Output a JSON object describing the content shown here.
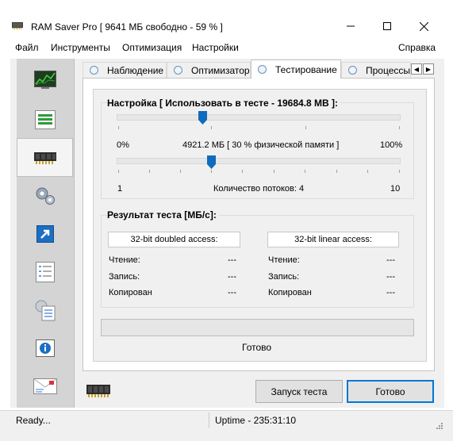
{
  "window": {
    "title": "RAM Saver Pro [ 9641 МБ свободно - 59 % ]",
    "controls": {
      "minimize": "—",
      "maximize": "☐",
      "close": "✕"
    }
  },
  "menu": {
    "file": "Файл",
    "tools": "Инструменты",
    "optimize": "Оптимизация",
    "settings": "Настройки",
    "help": "Справка"
  },
  "sidebar": {
    "items": [
      {
        "icon": "monitor-chart-icon"
      },
      {
        "icon": "list-bars-icon"
      },
      {
        "icon": "ram-chip-icon",
        "active": true
      },
      {
        "icon": "gears-icon"
      },
      {
        "icon": "shortcut-arrow-icon"
      },
      {
        "icon": "checklist-icon"
      },
      {
        "icon": "settings-document-icon"
      },
      {
        "icon": "info-icon"
      },
      {
        "icon": "envelope-icon"
      }
    ]
  },
  "tabs": {
    "monitoring": "Наблюдение",
    "optimizer": "Оптимизатор",
    "testing": "Тестирование",
    "processes": "Процессы",
    "active": "testing"
  },
  "setup": {
    "title": "Настройка [ Использовать в тесте - 19684.8 MB ]:",
    "memory_slider": {
      "min_label": "0%",
      "max_label": "100%",
      "value_label": "4921.2 МБ [ 30 % физической памяти ]",
      "value_percent": 30
    },
    "threads_slider": {
      "min_label": "1",
      "max_label": "10",
      "value_label": "Количество потоков: 4",
      "value": 4
    }
  },
  "results": {
    "title": "Результат теста [МБ/с]:",
    "doubled": {
      "header": "32-bit doubled access:",
      "read_label": "Чтение:",
      "read_value": "---",
      "write_label": "Запись:",
      "write_value": "---",
      "copy_label": "Копирован",
      "copy_value": "---"
    },
    "linear": {
      "header": "32-bit linear access:",
      "read_label": "Чтение:",
      "read_value": "---",
      "write_label": "Запись:",
      "write_value": "---",
      "copy_label": "Копирован",
      "copy_value": "---"
    }
  },
  "progress": {
    "value_percent": 0,
    "status": "Готово"
  },
  "buttons": {
    "run_test": "Запуск теста",
    "done": "Готово"
  },
  "statusbar": {
    "left": "Ready...",
    "uptime": "Uptime - 235:31:10"
  },
  "colors": {
    "accent": "#0078d7",
    "thumb": "#0f6cbd"
  }
}
